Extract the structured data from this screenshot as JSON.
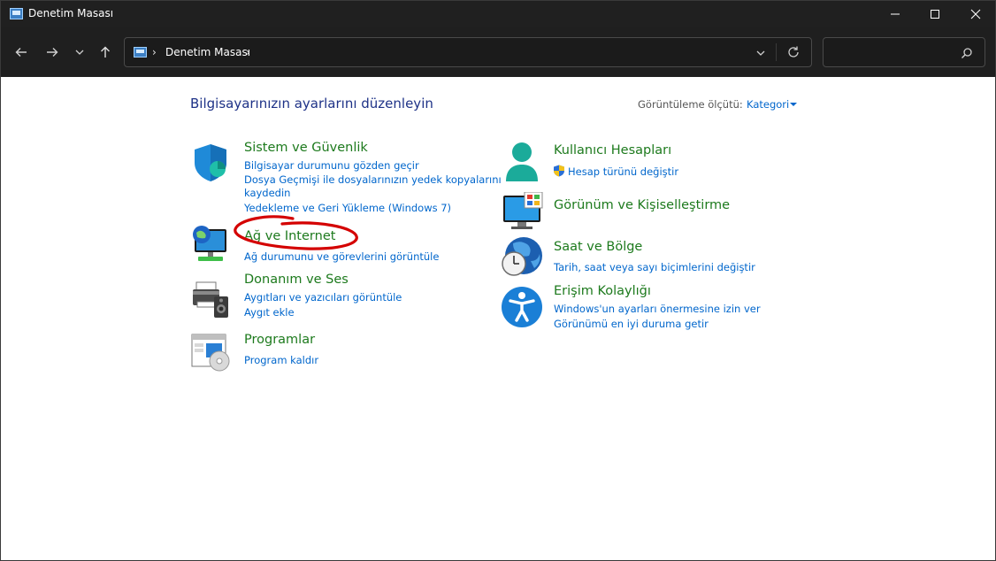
{
  "window": {
    "title": "Denetim Masası",
    "controls": {
      "minimize": "—",
      "maximize": "☐",
      "close": "✕"
    }
  },
  "address": {
    "crumb": "Denetim Masası",
    "separator": "›",
    "search_placeholder": ""
  },
  "content": {
    "page_title": "Bilgisayarınızın ayarlarını düzenleyin",
    "view_by_label": "Görüntüleme ölçütü:",
    "view_by_value": "Kategori"
  },
  "categories": {
    "system": {
      "title": "Sistem ve Güvenlik",
      "links": [
        "Bilgisayar durumunu gözden geçir",
        "Dosya Geçmişi ile dosyalarınızın yedek kopyalarını",
        "kaydedin",
        "Yedekleme ve Geri Yükleme (Windows 7)"
      ]
    },
    "network": {
      "title": "Ağ ve Internet",
      "links": [
        "Ağ durumunu ve görevlerini görüntüle"
      ]
    },
    "hardware": {
      "title": "Donanım ve Ses",
      "links": [
        "Aygıtları ve yazıcıları görüntüle",
        "Aygıt ekle"
      ]
    },
    "programs": {
      "title": "Programlar",
      "links": [
        "Program kaldır"
      ]
    },
    "users": {
      "title": "Kullanıcı Hesapları",
      "links": [
        "Hesap türünü değiştir"
      ]
    },
    "appearance": {
      "title": "Görünüm ve Kişiselleştirme",
      "links": []
    },
    "clock": {
      "title": "Saat ve Bölge",
      "links": [
        "Tarih, saat veya sayı biçimlerini değiştir"
      ]
    },
    "access": {
      "title": "Erişim Kolaylığı",
      "links": [
        "Windows'un ayarları önermesine izin ver",
        "Görünümü en iyi duruma getir"
      ]
    }
  },
  "colors": {
    "title_bar": "#202020",
    "category_title": "#1d7a1d",
    "link": "#0066cc",
    "page_title": "#1e3287",
    "annotation": "#d40000"
  },
  "icons": {
    "back": "arrow-left-icon",
    "forward": "arrow-right-icon",
    "recent": "chevron-down-icon",
    "up": "arrow-up-icon",
    "refresh": "refresh-icon",
    "search": "search-icon"
  }
}
